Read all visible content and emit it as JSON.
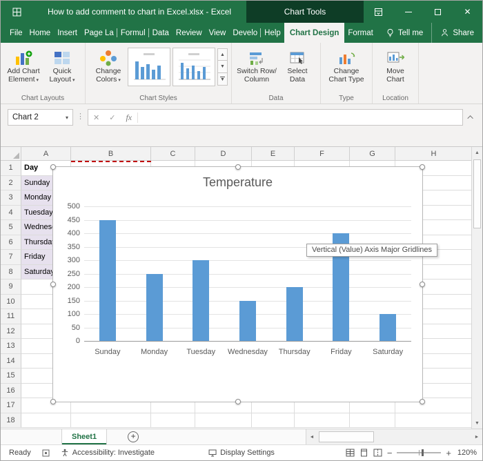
{
  "colors": {
    "excel_green": "#217346",
    "titlebar_dark_green": "#0e3d26",
    "bar_blue": "#5b9bd5",
    "selection_fill": "#e7e1ee",
    "copied_range_red": "#c00000"
  },
  "titlebar": {
    "title": "How to add comment to chart in Excel.xlsx - Excel",
    "context_label": "Chart Tools"
  },
  "menubar": {
    "tabs": [
      {
        "label": "File"
      },
      {
        "label": "Home"
      },
      {
        "label": "Insert"
      },
      {
        "label": "Page La",
        "clipped": true
      },
      {
        "label": "Formul",
        "clipped": true
      },
      {
        "label": "Data"
      },
      {
        "label": "Review"
      },
      {
        "label": "View"
      },
      {
        "label": "Develo",
        "clipped": true
      },
      {
        "label": "Help"
      },
      {
        "label": "Chart Design",
        "active": true
      },
      {
        "label": "Format"
      }
    ],
    "tell_me": "Tell me",
    "share": "Share"
  },
  "ribbon": {
    "groups": {
      "chart_layouts": {
        "label": "Chart Layouts",
        "add_chart_element": {
          "line1": "Add Chart",
          "line2": "Element"
        },
        "quick_layout": {
          "line1": "Quick",
          "line2": "Layout"
        }
      },
      "chart_styles": {
        "label": "Chart Styles",
        "change_colors": {
          "line1": "Change",
          "line2": "Colors"
        }
      },
      "data": {
        "label": "Data",
        "switch_row_column": {
          "line1": "Switch Row/",
          "line2": "Column"
        },
        "select_data": {
          "line1": "Select",
          "line2": "Data"
        }
      },
      "type": {
        "label": "Type",
        "change_chart_type": {
          "line1": "Change",
          "line2": "Chart Type"
        }
      },
      "location": {
        "label": "Location",
        "move_chart": {
          "line1": "Move",
          "line2": "Chart"
        }
      }
    }
  },
  "formula_bar": {
    "name_box": "Chart 2",
    "fx_label": "fx",
    "formula_value": ""
  },
  "grid": {
    "columns": [
      "A",
      "B",
      "C",
      "D",
      "E",
      "F",
      "G",
      "H"
    ],
    "row_count": 18,
    "cells": [
      {
        "r": 1,
        "c": "A",
        "text": "Day",
        "bold": true
      },
      {
        "r": 2,
        "c": "A",
        "text": "Sunday",
        "shaded": true
      },
      {
        "r": 3,
        "c": "A",
        "text": "Monday",
        "shaded": true
      },
      {
        "r": 4,
        "c": "A",
        "text": "Tuesday",
        "shaded": true
      },
      {
        "r": 5,
        "c": "A",
        "text": "Wednesday",
        "shaded": true
      },
      {
        "r": 6,
        "c": "A",
        "text": "Thursday",
        "shaded": true
      },
      {
        "r": 7,
        "c": "A",
        "text": "Friday",
        "shaded": true
      },
      {
        "r": 8,
        "c": "A",
        "text": "Saturday",
        "shaded": true
      }
    ]
  },
  "chart_data": {
    "type": "bar",
    "title": "Temperature",
    "categories": [
      "Sunday",
      "Monday",
      "Tuesday",
      "Wednesday",
      "Thursday",
      "Friday",
      "Saturday"
    ],
    "values": [
      450,
      250,
      300,
      150,
      200,
      400,
      100
    ],
    "xlabel": "",
    "ylabel": "",
    "ylim": [
      0,
      500
    ],
    "ytick_step": 50,
    "bar_color": "#5b9bd5",
    "grid": true,
    "legend": false
  },
  "tooltip": {
    "text": "Vertical (Value) Axis Major Gridlines"
  },
  "sheet_bar": {
    "tabs": [
      "Sheet1"
    ]
  },
  "status_bar": {
    "mode": "Ready",
    "accessibility": "Accessibility: Investigate",
    "display_settings": "Display Settings",
    "zoom": "120%"
  },
  "icons": {
    "dropdown": "▾",
    "cancel": "✕",
    "enter": "✓",
    "dots_divider": "⋮",
    "scroll_up": "▲",
    "scroll_down": "▼",
    "scroll_left": "◄",
    "scroll_right": "►",
    "gallery_up": "▲",
    "gallery_down": "▼",
    "gallery_more": "▼",
    "add_sheet": "+",
    "zoom_out": "−",
    "zoom_in": "+",
    "close": "✕"
  }
}
